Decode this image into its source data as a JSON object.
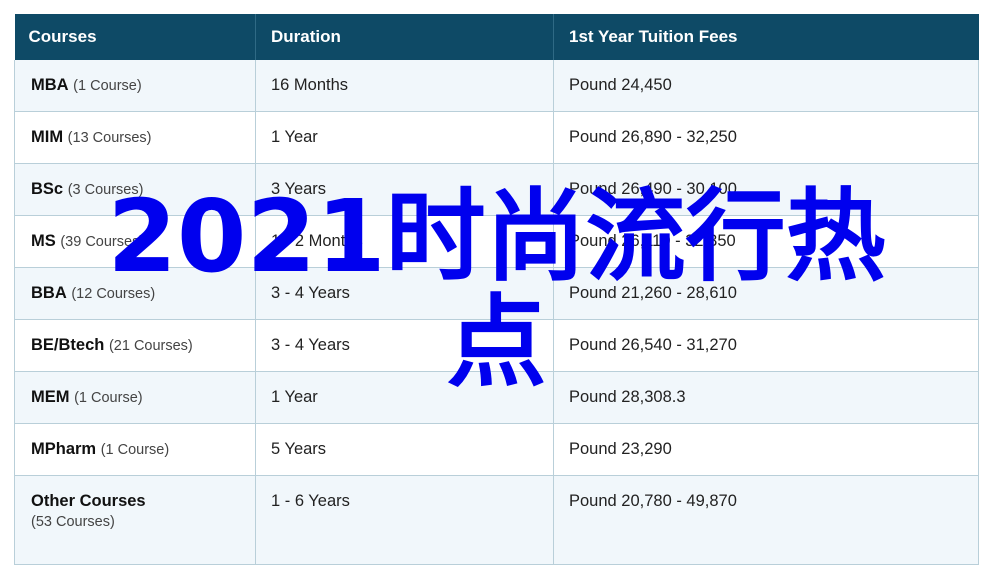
{
  "table": {
    "headers": [
      "Courses",
      "Duration",
      "1st Year Tuition Fees"
    ],
    "rows": [
      {
        "name": "MBA",
        "count": "(1 Course)",
        "duration": "16 Months",
        "fees": "Pound 24,450"
      },
      {
        "name": "MIM",
        "count": "(13 Courses)",
        "duration": "1 Year",
        "fees": "Pound 26,890 - 32,250"
      },
      {
        "name": "BSc",
        "count": "(3 Courses)",
        "duration": "3 Years",
        "fees": "Pound 26,490 - 30,100"
      },
      {
        "name": "MS",
        "count": "(39 Courses)",
        "duration": "1 - 2 Months",
        "fees": "Pound 26,110 - 32,350"
      },
      {
        "name": "BBA",
        "count": "(12 Courses)",
        "duration": "3 - 4 Years",
        "fees": "Pound 21,260 - 28,610"
      },
      {
        "name": "BE/Btech",
        "count": "(21 Courses)",
        "duration": "3 - 4 Years",
        "fees": "Pound 26,540 - 31,270"
      },
      {
        "name": "MEM",
        "count": "(1 Course)",
        "duration": "1 Year",
        "fees": "Pound 28,308.3"
      },
      {
        "name": "MPharm",
        "count": "(1 Course)",
        "duration": "5 Years",
        "fees": "Pound 23,290"
      },
      {
        "name": "Other Courses",
        "count": "(53 Courses)",
        "duration": "1 - 6 Years",
        "fees": "Pound 20,780 - 49,870"
      }
    ]
  },
  "overlay": {
    "line1": "2021时尚流行热",
    "line2": "点",
    "color": "#0000ee"
  },
  "colors": {
    "header_bg": "#0e4a66",
    "row_alt_bg": "#f1f7fb",
    "border": "#b9cfd9"
  }
}
